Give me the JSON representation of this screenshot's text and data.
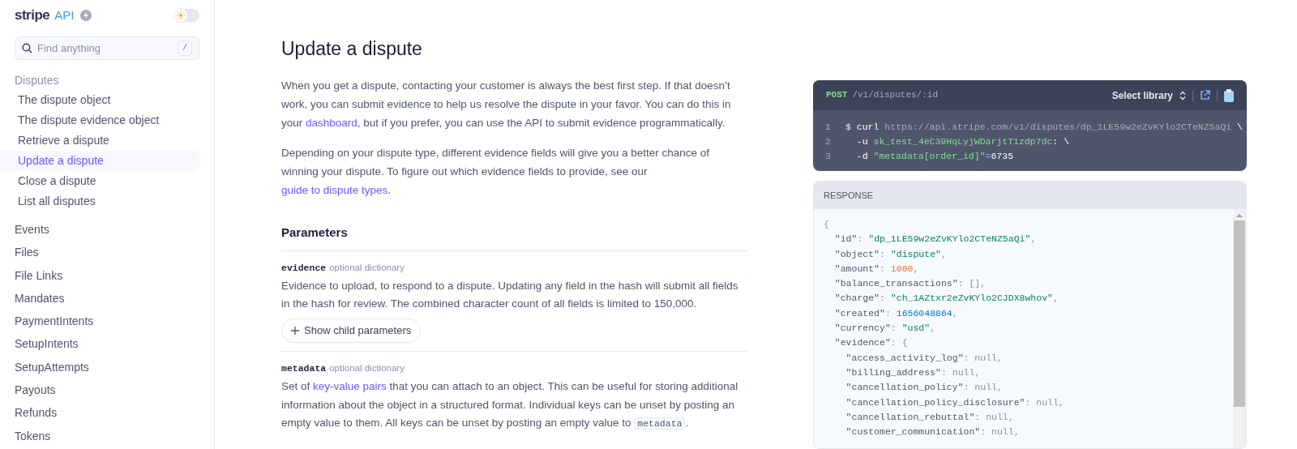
{
  "sidebar": {
    "logo": "stripe",
    "logo_badge": "API",
    "theme_toggle": {
      "on": false
    },
    "search": {
      "placeholder": "Find anything",
      "shortcut": "/"
    },
    "nav": [
      {
        "label": "Disputes",
        "children": [
          {
            "label": "The dispute object",
            "selected": false
          },
          {
            "label": "The dispute evidence object",
            "selected": false
          },
          {
            "label": "Retrieve a dispute",
            "selected": false
          },
          {
            "label": "Update a dispute",
            "selected": true
          },
          {
            "label": "Close a dispute",
            "selected": false
          },
          {
            "label": "List all disputes",
            "selected": false
          }
        ]
      },
      {
        "label": "Events",
        "selected": false
      },
      {
        "label": "Files",
        "selected": false
      },
      {
        "label": "File Links",
        "selected": false
      },
      {
        "label": "Mandates",
        "selected": false
      },
      {
        "label": "PaymentIntents",
        "selected": false
      },
      {
        "label": "SetupIntents",
        "selected": false
      },
      {
        "label": "SetupAttempts",
        "selected": false
      },
      {
        "label": "Payouts",
        "selected": false
      },
      {
        "label": "Refunds",
        "selected": false
      },
      {
        "label": "Tokens",
        "selected": false
      }
    ]
  },
  "main": {
    "title": "Update a dispute",
    "paragraphs": [
      [
        {
          "kind": "text",
          "text": "When you get a dispute, contacting your customer is always the best first step. If that doesn’t work, you can submit evidence to help us resolve the dispute in your favor. You can do this in your "
        },
        {
          "kind": "link",
          "text": "dashboard"
        },
        {
          "kind": "text",
          "text": ", but if you prefer, you can use the API to submit evidence programmatically."
        }
      ],
      [
        {
          "kind": "text",
          "text": "Depending on your dispute type, different evidence fields will give you a better chance of winning your dispute. To figure out which evidence fields to provide, see our "
        },
        {
          "kind": "link",
          "text": "guide to dispute types"
        },
        {
          "kind": "text",
          "text": "."
        }
      ]
    ],
    "parameters_heading": "Parameters",
    "parameters": [
      {
        "name": "evidence",
        "type": "optional dictionary",
        "description": [
          {
            "kind": "text",
            "text": "Evidence to upload, to respond to a dispute. Updating any field in the hash will submit all fields in the hash for review. The combined character count of all fields is limited to 150,000."
          }
        ],
        "child_button": "Show child parameters"
      },
      {
        "name": "metadata",
        "type": "optional dictionary",
        "description": [
          {
            "kind": "text",
            "text": "Set of "
          },
          {
            "kind": "link",
            "text": "key-value pairs"
          },
          {
            "kind": "text",
            "text": " that you can attach to an object. This can be useful for storing additional information about the object in a structured format. Individual keys can be unset by posting an empty value to them. All keys can be unset by posting an empty value to "
          },
          {
            "kind": "code",
            "text": "metadata"
          },
          {
            "kind": "text",
            "text": "."
          }
        ]
      }
    ]
  },
  "request": {
    "method": "POST",
    "path": "/v1/disputes/:id",
    "library_button": "Select library",
    "lines": [
      {
        "number": "1",
        "tokens": [
          {
            "kind": "prompt",
            "text": "$ "
          },
          {
            "kind": "command",
            "text": "curl"
          },
          {
            "kind": "url",
            "text": " https://api.stripe.com/v1/disputes/dp_1LE59w2eZvKYlo2CTeNZ5aQi "
          },
          {
            "kind": "command",
            "text": "\\"
          }
        ]
      },
      {
        "number": "2",
        "tokens": [
          {
            "kind": "command",
            "text": "  -u "
          },
          {
            "kind": "string",
            "text": "sk_test_4eC39HqLyjWDarjtT1zdp7dc"
          },
          {
            "kind": "command",
            "text": ": \\"
          }
        ]
      },
      {
        "number": "3",
        "tokens": [
          {
            "kind": "command",
            "text": "  -d "
          },
          {
            "kind": "string",
            "text": "\"metadata[order_id]\""
          },
          {
            "kind": "operator",
            "text": "="
          },
          {
            "kind": "command",
            "text": "6735"
          }
        ]
      }
    ]
  },
  "response": {
    "label": "RESPONSE",
    "lines": [
      [
        {
          "kind": "punct",
          "text": "{"
        }
      ],
      [
        {
          "kind": "key",
          "text": "  \"id\""
        },
        {
          "kind": "punct",
          "text": ": "
        },
        {
          "kind": "string",
          "text": "\"dp_1LE59w2eZvKYlo2CTeNZ5aQi\""
        },
        {
          "kind": "punct",
          "text": ","
        }
      ],
      [
        {
          "kind": "key",
          "text": "  \"object\""
        },
        {
          "kind": "punct",
          "text": ": "
        },
        {
          "kind": "string",
          "text": "\"dispute\""
        },
        {
          "kind": "punct",
          "text": ","
        }
      ],
      [
        {
          "kind": "key",
          "text": "  \"amount\""
        },
        {
          "kind": "punct",
          "text": ": "
        },
        {
          "kind": "number",
          "text": "1000"
        },
        {
          "kind": "punct",
          "text": ","
        }
      ],
      [
        {
          "kind": "key",
          "text": "  \"balance_transactions\""
        },
        {
          "kind": "punct",
          "text": ": [],"
        }
      ],
      [
        {
          "kind": "key",
          "text": "  \"charge\""
        },
        {
          "kind": "punct",
          "text": ": "
        },
        {
          "kind": "string",
          "text": "\"ch_1AZtxr2eZvKYlo2CJDX8whov\""
        },
        {
          "kind": "punct",
          "text": ","
        }
      ],
      [
        {
          "kind": "key",
          "text": "  \"created\""
        },
        {
          "kind": "punct",
          "text": ": "
        },
        {
          "kind": "timestamp",
          "text": "1656048864"
        },
        {
          "kind": "punct",
          "text": ","
        }
      ],
      [
        {
          "kind": "key",
          "text": "  \"currency\""
        },
        {
          "kind": "punct",
          "text": ": "
        },
        {
          "kind": "string",
          "text": "\"usd\""
        },
        {
          "kind": "punct",
          "text": ","
        }
      ],
      [
        {
          "kind": "key",
          "text": "  \"evidence\""
        },
        {
          "kind": "punct",
          "text": ": {"
        }
      ],
      [
        {
          "kind": "key",
          "text": "    \"access_activity_log\""
        },
        {
          "kind": "punct",
          "text": ": null,"
        }
      ],
      [
        {
          "kind": "key",
          "text": "    \"billing_address\""
        },
        {
          "kind": "punct",
          "text": ": null,"
        }
      ],
      [
        {
          "kind": "key",
          "text": "    \"cancellation_policy\""
        },
        {
          "kind": "punct",
          "text": ": null,"
        }
      ],
      [
        {
          "kind": "key",
          "text": "    \"cancellation_policy_disclosure\""
        },
        {
          "kind": "punct",
          "text": ": null,"
        }
      ],
      [
        {
          "kind": "key",
          "text": "    \"cancellation_rebuttal\""
        },
        {
          "kind": "punct",
          "text": ": null,"
        }
      ],
      [
        {
          "kind": "key",
          "text": "    \"customer_communication\""
        },
        {
          "kind": "punct",
          "text": ": null,"
        }
      ]
    ]
  }
}
